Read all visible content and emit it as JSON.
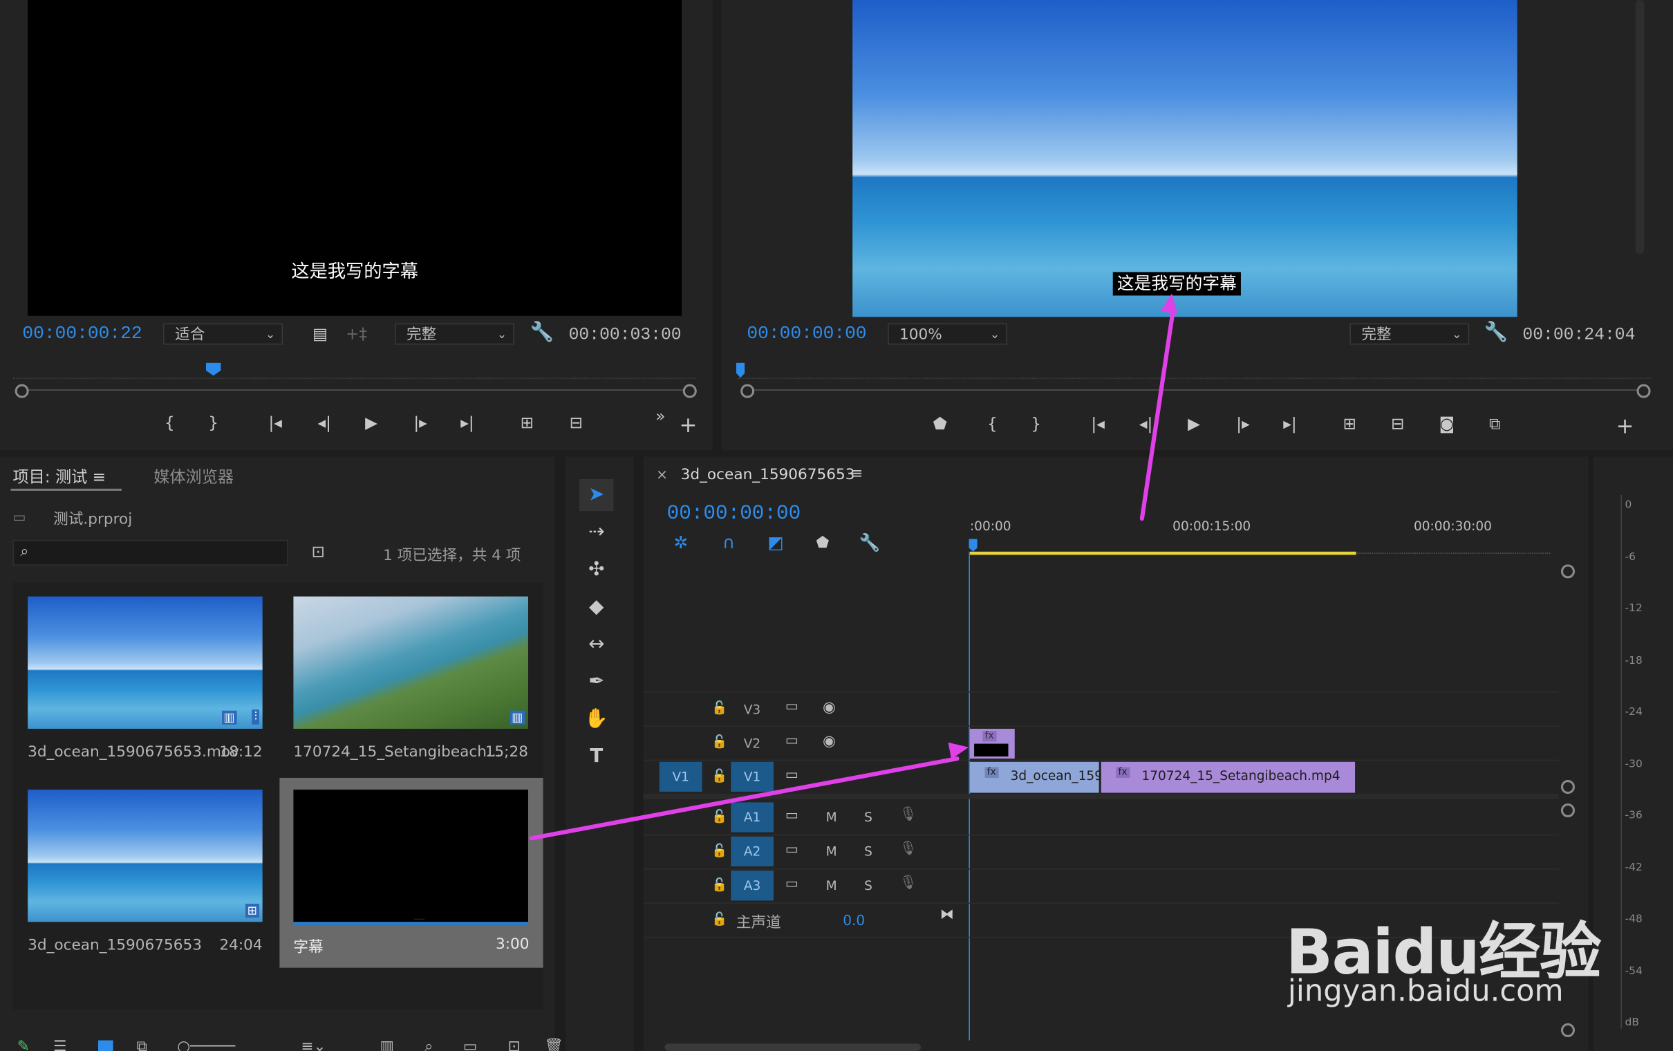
{
  "source_monitor": {
    "subtitle_text": "这是我写的字幕",
    "timecode": "00:00:00:22",
    "fit_label": "适合",
    "quality_label": "完整",
    "duration": "00:00:03:00"
  },
  "program_monitor": {
    "subtitle_text": "这是我写的字幕",
    "timecode": "00:00:00:00",
    "zoom_label": "100%",
    "quality_label": "完整",
    "duration": "00:00:24:04"
  },
  "project_panel": {
    "tab_project": "项目: 测试",
    "tab_media": "媒体浏览器",
    "project_file": "测试.prproj",
    "selection_info": "1 项已选择，共 4 项",
    "items": [
      {
        "name": "3d_ocean_1590675653.mov",
        "duration": "18:12"
      },
      {
        "name": "170724_15_Setangibeach...",
        "duration": "15;28"
      },
      {
        "name": "3d_ocean_1590675653",
        "duration": "24:04"
      },
      {
        "name": "字幕",
        "duration": "3:00"
      }
    ]
  },
  "timeline": {
    "sequence_name": "3d_ocean_1590675653",
    "timecode": "00:00:00:00",
    "ruler": [
      ":00:00",
      "00:00:15:00",
      "00:00:30:00"
    ],
    "tracks": {
      "v3": "V3",
      "v2": "V2",
      "v1": "V1",
      "v1_src": "V1",
      "a1": "A1",
      "a2": "A2",
      "a3": "A3",
      "master": "主声道",
      "master_value": "0.0",
      "m": "M",
      "s": "S"
    },
    "clips": {
      "clip_a": "3d_ocean_159",
      "clip_b": "170724_15_Setangibeach.mp4",
      "fx": "fx"
    }
  },
  "audio_meter": {
    "labels": [
      "0",
      "-6",
      "-12",
      "-18",
      "-24",
      "-30",
      "-36",
      "-42",
      "-48",
      "-54",
      "dB"
    ]
  },
  "watermark": {
    "text": "Baidu经验",
    "url": "jingyan.baidu.com"
  },
  "colors": {
    "accent_blue": "#2d8ceb",
    "clip_v1": "#8fa6d8",
    "clip_v1b": "#a98ad8",
    "arrow": "#e040e8",
    "work_area": "#e6d43a"
  }
}
